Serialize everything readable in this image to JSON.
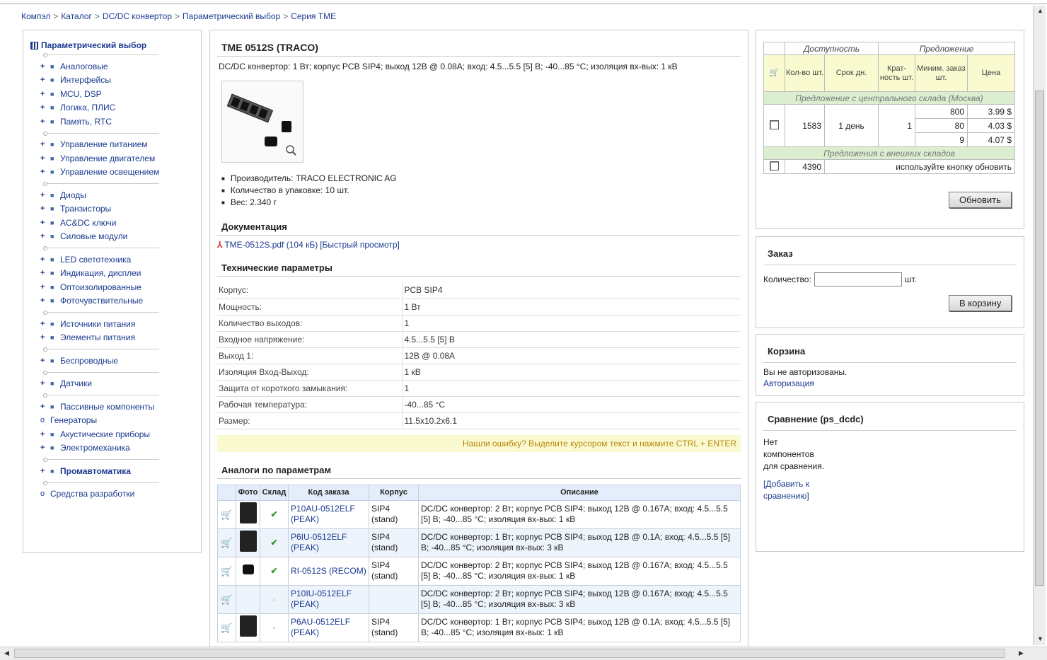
{
  "breadcrumb": [
    "Компэл",
    "Каталог",
    "DC/DC конвертор",
    "Параметрический выбор",
    "Серия TME"
  ],
  "breadcrumb_separator": ">",
  "sidebar": {
    "title": "Параметрический выбор",
    "groups": [
      [
        "Аналоговые",
        "Интерфейсы",
        "MCU, DSP",
        "Логика, ПЛИС",
        "Память, RTC"
      ],
      [
        "Управление питанием",
        "Управление двигателем",
        "Управление освещением"
      ],
      [
        "Диоды",
        "Транзисторы",
        "AC&DC ключи",
        "Силовые модули"
      ],
      [
        "LED светотехника",
        "Индикация, дисплеи",
        "Оптоизолированные",
        "Фоточувствительные"
      ],
      [
        "Источники питания",
        "Элементы питания"
      ],
      [
        "Беспроводные"
      ],
      [
        "Датчики"
      ],
      [
        "Пассивные компоненты",
        "Генераторы",
        "Акустические приборы",
        "Электромеханика"
      ],
      [
        "Промавтоматика"
      ],
      [
        "Средства разработки"
      ]
    ]
  },
  "product": {
    "title": "TME 0512S (TRACO)",
    "description": "DC/DC конвертор: 1 Вт; корпус PCB SIP4; выход 12В @ 0.08A; вход: 4.5...5.5 [5] В; -40...85 °C; изоляция вх-вых: 1 кВ",
    "bullets": [
      "Производитель: TRACO ELECTRONIC AG",
      "Количество в упаковке: 10 шт.",
      "Вес: 2.340 г"
    ],
    "doc_title": "Документация",
    "doc_link": "TME-0512S.pdf (104 кБ)",
    "doc_quick": "[Быстрый просмотр]",
    "params_title": "Технические параметры",
    "params": [
      [
        "Корпус:",
        "PCB SIP4"
      ],
      [
        "Мощность:",
        "1 Вт"
      ],
      [
        "Количество выходов:",
        "1"
      ],
      [
        "Входное напряжение:",
        "4.5...5.5 [5] В"
      ],
      [
        "Выход 1:",
        "12В @ 0.08A"
      ],
      [
        "Изоляция Вход-Выход:",
        "1 кВ"
      ],
      [
        "Защита от короткого замыкания:",
        "1"
      ],
      [
        "Рабочая температура:",
        "-40...85 °C"
      ],
      [
        "Размер:",
        "11.5x10.2x6.1"
      ]
    ],
    "notice": "Нашли ошибку? Выделите курсором текст и нажмите CTRL + ENTER",
    "analogs_title": "Аналоги по параметрам",
    "analogs_headers": [
      "",
      "Фото",
      "Склад",
      "Код заказа",
      "Корпус",
      "Описание"
    ],
    "analogs": [
      {
        "photo": "module",
        "stock": "check",
        "code": "P10AU-0512ELF (PEAK)",
        "case": "SIP4 (stand)",
        "desc": "DC/DC конвертор: 2 Вт; корпус PCB SIP4; выход 12В @ 0.167A; вход: 4.5...5.5 [5] В; -40...85 °C; изоляция вх-вых: 1 кВ"
      },
      {
        "photo": "module",
        "stock": "check",
        "code": "P6IU-0512ELF (PEAK)",
        "case": "SIP4 (stand)",
        "desc": "DC/DC конвертор: 1 Вт; корпус PCB SIP4; выход 12В @ 0.1A; вход: 4.5...5.5 [5] В; -40...85 °C; изоляция вх-вых: 3 кВ"
      },
      {
        "photo": "small",
        "stock": "check",
        "code": "RI-0512S (RECOM)",
        "case": "SIP4 (stand)",
        "desc": "DC/DC конвертор: 2 Вт; корпус PCB SIP4; выход 12В @ 0.167A; вход: 4.5...5.5 [5] В; -40...85 °C; изоляция вх-вых: 1 кВ"
      },
      {
        "photo": "none",
        "stock": "dash",
        "code": "P10IU-0512ELF (PEAK)",
        "case": "",
        "desc": "DC/DC конвертор: 2 Вт; корпус PCB SIP4; выход 12В @ 0.167A; вход: 4.5...5.5 [5] В; -40...85 °C; изоляция вх-вых: 3 кВ"
      },
      {
        "photo": "module",
        "stock": "dash",
        "code": "P6AU-0512ELF (PEAK)",
        "case": "SIP4 (stand)",
        "desc": "DC/DC конвертор: 1 Вт; корпус PCB SIP4; выход 12В @ 0.1A; вход: 4.5...5.5 [5] В; -40...85 °C; изоляция вх-вых: 1 кВ"
      }
    ]
  },
  "offer": {
    "availability": "Доступность",
    "proposal": "Предложение",
    "col_qty": "Кол-во шт.",
    "col_term": "Срок дн.",
    "col_mult": "Крат-ность шт.",
    "col_min": "Миним. заказ шт.",
    "col_price": "Цена",
    "central_label": "Предложение с центрального склада (Москва)",
    "central": {
      "qty": "1583",
      "term": "1 день",
      "mult": "1",
      "tiers": [
        [
          "800",
          "3.99 $"
        ],
        [
          "80",
          "4.03 $"
        ],
        [
          "9",
          "4.07 $"
        ]
      ]
    },
    "external_label": "Предложения с внешних складов",
    "external": {
      "qty": "4390",
      "note": "используйте кнопку обновить"
    },
    "refresh_button": "Обновить"
  },
  "order": {
    "title": "Заказ",
    "qty_label": "Количество:",
    "qty_value": "",
    "unit": "шт.",
    "cart_button": "В корзину"
  },
  "basket": {
    "title": "Корзина",
    "status": "Вы не авторизованы.",
    "login_link": "Авторизация"
  },
  "compare": {
    "title": "Сравнение (ps_dcdc)",
    "empty_text": "Нет компонентов для сравнения.",
    "add_link": "[Добавить к сравнению]"
  }
}
